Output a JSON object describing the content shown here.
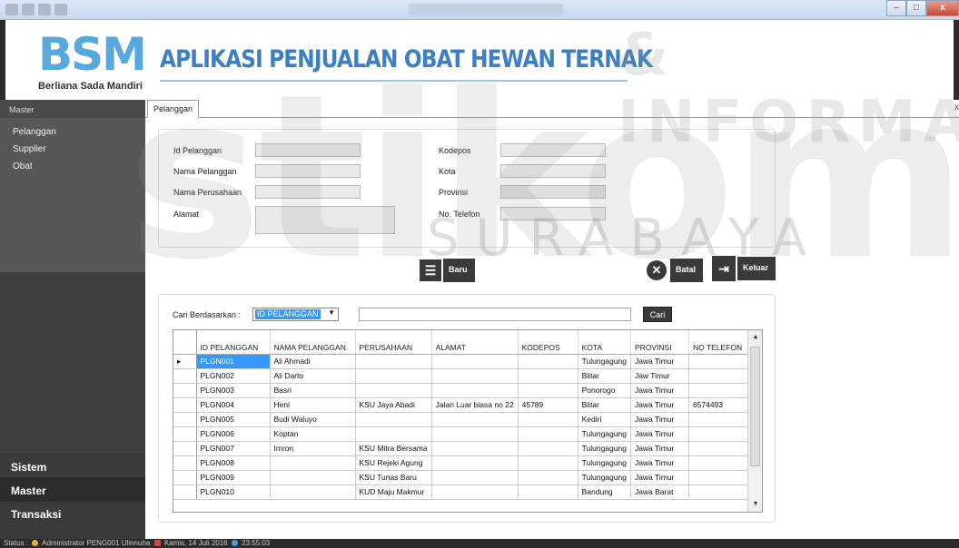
{
  "window": {
    "close_label": "x"
  },
  "header": {
    "logo": "BSM",
    "company": "Berliana Sada Mandiri",
    "title": "APLIKASI PENJUALAN OBAT HEWAN TERNAK"
  },
  "watermark": {
    "top": "& INFORMATIKA",
    "main": "stikom",
    "sub": "SURABAYA"
  },
  "sidebar": {
    "header": "Master",
    "items": [
      {
        "label": "Pelanggan"
      },
      {
        "label": "Supplier"
      },
      {
        "label": "Obat"
      }
    ],
    "sections": [
      {
        "label": "Sistem"
      },
      {
        "label": "Master"
      },
      {
        "label": "Transaksi"
      }
    ]
  },
  "tabs": [
    {
      "label": "Pelanggan"
    }
  ],
  "tab_close": "x",
  "form": {
    "id_label": "Id Pelanggan",
    "nama_label": "Nama Pelanggan",
    "perusahaan_label": "Nama Perusahaan",
    "alamat_label": "Alamat",
    "kodepos_label": "Kodepos",
    "kota_label": "Kota",
    "provinsi_label": "Provinsi",
    "telefon_label": "No. Telefon"
  },
  "buttons": {
    "baru": "Baru",
    "batal": "Batal",
    "keluar": "Keluar",
    "cari": "Cari"
  },
  "search": {
    "label": "Cari Berdasarkan :",
    "selected": "ID PELANGGAN"
  },
  "table": {
    "headers": [
      "ID PELANGGAN",
      "NAMA PELANGGAN",
      "PERUSAHAAN",
      "ALAMAT",
      "KODEPOS",
      "KOTA",
      "PROVINSI",
      "NO TELEFON"
    ],
    "rows": [
      [
        "PLGN001",
        "Ali Ahmadi",
        "",
        "",
        "",
        "Tulungagung",
        "Jawa Timur",
        ""
      ],
      [
        "PLGN002",
        "Ali Darto",
        "",
        "",
        "",
        "Blitar",
        "Jaw Timur",
        ""
      ],
      [
        "PLGN003",
        "Basri",
        "",
        "",
        "",
        "Ponorogo",
        "Jawa Timur",
        ""
      ],
      [
        "PLGN004",
        "Heni",
        "KSU Jaya Abadi",
        "Jalan Luar biasa no 22",
        "45789",
        "Blitar",
        "Jawa Timur",
        "6574493"
      ],
      [
        "PLGN005",
        "Budi Waluyo",
        "",
        "",
        "",
        "Kediri",
        "Jawa Timur",
        ""
      ],
      [
        "PLGN006",
        "Koptan",
        "",
        "",
        "",
        "Tulungagung",
        "Jawa Timur",
        ""
      ],
      [
        "PLGN007",
        "Imron",
        "KSU Mitra Bersama",
        "",
        "",
        "Tulungagung",
        "Jawa Timur",
        ""
      ],
      [
        "PLGN008",
        "",
        "KSU Rejeki Agung",
        "",
        "",
        "Tulungagung",
        "Jawa Timur",
        ""
      ],
      [
        "PLGN009",
        "",
        "KSU Tunas Baru",
        "",
        "",
        "Tulungagung",
        "Jawa Timur",
        ""
      ],
      [
        "PLGN010",
        "",
        "KUD Maju Makmur",
        "",
        "",
        "Bandung",
        "Jawa Barat",
        ""
      ]
    ]
  },
  "status": {
    "label": "Status :",
    "role": "Administrator",
    "user_id": "PENG001",
    "user_name": "Ulinnuha",
    "date": "Kamis, 14 Juli 2016",
    "time": "23:55:03"
  }
}
